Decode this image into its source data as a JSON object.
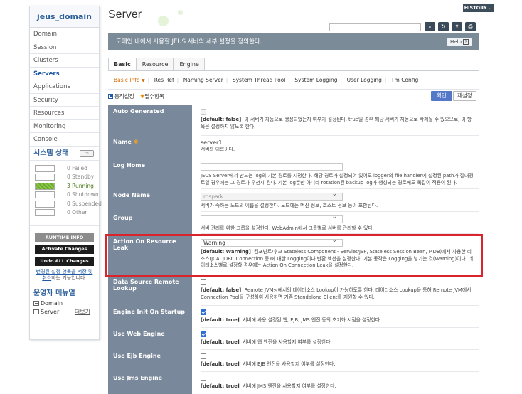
{
  "sidebar": {
    "domain": "jeus_domain",
    "items": [
      {
        "label": "Domain",
        "active": false
      },
      {
        "label": "Session",
        "active": false
      },
      {
        "label": "Clusters",
        "active": false
      },
      {
        "label": "Servers",
        "active": true
      },
      {
        "label": "Applications",
        "active": false
      },
      {
        "label": "Security",
        "active": false
      },
      {
        "label": "Resources",
        "active": false
      },
      {
        "label": "Monitoring",
        "active": false
      },
      {
        "label": "Console",
        "active": false
      }
    ],
    "system_status": {
      "title": "시스템 상태",
      "rows": [
        {
          "label": "0 Failed",
          "fill": 0
        },
        {
          "label": "0 Standby",
          "fill": 0
        },
        {
          "label": "3 Running",
          "fill": 1
        },
        {
          "label": "0 Shutdown",
          "fill": 0
        },
        {
          "label": "0 Suspended",
          "fill": 0
        },
        {
          "label": "0 Other",
          "fill": 0
        }
      ]
    },
    "runtime_info": "RUNTIME INFO",
    "activate_changes": "Activate Changes",
    "undo_all_changes": "Undo ALL Changes",
    "pending_note_link": "변경된 설정 항목을 저장 및 취소",
    "pending_note_rest": "하는 기능입니다.",
    "ops_menu": {
      "title": "운영자 메뉴얼",
      "items": [
        {
          "label": "Domain"
        },
        {
          "label": "Server",
          "more": "더보기"
        }
      ]
    }
  },
  "header": {
    "title": "Server",
    "history": "HISTORY",
    "search_placeholder": "",
    "banner": "도메인 내에서 사용할 JEUS 서버의 세부 설정을 정의한다.",
    "help": "Help"
  },
  "tabs": [
    {
      "label": "Basic",
      "active": true
    },
    {
      "label": "Resource",
      "active": false
    },
    {
      "label": "Engine",
      "active": false
    }
  ],
  "subtabs": [
    {
      "label": "Basic Info",
      "active": true
    },
    {
      "label": "Res Ref",
      "active": false
    },
    {
      "label": "Naming Server",
      "active": false
    },
    {
      "label": "System Thread Pool",
      "active": false
    },
    {
      "label": "System Logging",
      "active": false
    },
    {
      "label": "User Logging",
      "active": false
    },
    {
      "label": "Tm Config",
      "active": false
    }
  ],
  "legend": {
    "dynamic": "동적설정",
    "required": "필수항목"
  },
  "actions": {
    "confirm": "확인",
    "reset": "재설정"
  },
  "fields": {
    "auto_generated": {
      "label": "Auto Generated",
      "default_tag": "[default: false]",
      "desc": "이 서버가 자동으로 생성되었는지 여부가 설정된다. true일 경우 해당 서버가 자동으로 삭제될 수 있으므로, 이 항목은 설정하지 않도록 한다."
    },
    "name": {
      "label": "Name",
      "value": "server1",
      "desc": "서버의 이름이다."
    },
    "log_home": {
      "label": "Log Home",
      "desc": "JEUS Server에서 만드는 log의 기본 경로를 지정한다. 해당 경로가 설정되어 있어도 logger의 file handler에 설정된 path가 절대경로일 경우에는 그 경로가 우선시 된다. 기본 log뿐만 아니라 rotation된 backup log가 생성되는 경로에도 똑같이 적용이 된다."
    },
    "node_name": {
      "label": "Node Name",
      "value": "mspark",
      "desc": "서버가 속하는 노드의 이름을 설정한다. 노드에는 머신 정보, 호스트 정보 등이 포함된다."
    },
    "group": {
      "label": "Group",
      "value": "",
      "desc": "서버 관리를 위한 그룹을 설정한다. WebAdmin에서 그룹별로 서버를 관리할 수 있다."
    },
    "action_on_resource_leak": {
      "label": "Action On Resource Leak",
      "value": "Warning",
      "default_tag": "[default: Warning]",
      "desc": "컴포넌트/후크 Stateless Component - Servlet/JSP, Stateless Session Bean, MDB)에서 사용한 리소스(JCA, JDBC Connection 등)에 대한 Logging이나 반환 액션을 설정한다. 기본 동작은 Logging을 남기는 것(Warning)이다. 데이터소스별로 설정할 경우에는 Action On Connection Leak을 설정한다."
    },
    "data_source_remote_lookup": {
      "label": "Data Source Remote Lookup",
      "default_tag": "[default: false]",
      "desc": "Remote JVM상에서의 데이터소스 Lookup이 가능하도록 한다. 데이터소스 Lookup을 통해 Remote JVM에서 Connection Pool을 구성하여 사용하면 기존 Standalone Client를 지원할 수 있다."
    },
    "engine_init_on_startup": {
      "label": "Engine Init On Startup",
      "default_tag": "[default: true]",
      "desc": "서버에 사용 설정된 웹, EJB, JMS 엔진 등의 초기화 시점을 설정한다."
    },
    "use_web_engine": {
      "label": "Use Web Engine",
      "default_tag": "[default: true]",
      "desc": "서버에 웹 엔진을 사용할지 여부를 설정한다."
    },
    "use_ejb_engine": {
      "label": "Use Ejb Engine",
      "default_tag": "[default: true]",
      "desc": "서버에 EJB 엔진을 사용할지 여부를 설정한다."
    },
    "use_jms_engine": {
      "label": "Use Jms Engine",
      "default_tag": "[default: true]",
      "desc": "서버에 JMS 엔진을 사용할지 여부를 설정한다."
    }
  },
  "colors": {
    "accent": "#5378c7",
    "label_bg": "#79889a",
    "highlight": "#d8242a",
    "banner": "#7c8b98"
  }
}
